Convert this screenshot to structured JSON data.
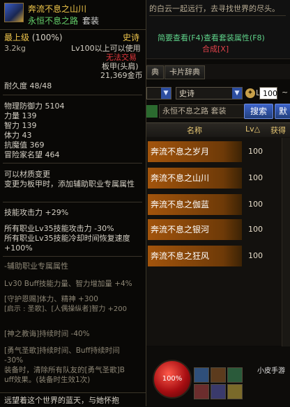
{
  "tooltip": {
    "item_name": "奔流不息之山川",
    "set_name": "永恒不息之路",
    "set_suffix": "套装",
    "level_req": "最上级",
    "level_pct": "(100%)",
    "rarity": "史诗",
    "weight": "3.2kg",
    "usable": "Lv100以上可以使用",
    "trade": "无法交易",
    "slot": "板甲(头肩)",
    "price": "21,369金币",
    "durability": "耐久度  48/48",
    "stats": [
      "物理防御力 5104",
      "力量 139",
      "智力 139",
      "体力 43",
      "抗魔值 369",
      "冒险家名望 464"
    ],
    "material": "可以材质变更",
    "material_note": "变更为板甲时，添加辅助职业专属属性",
    "skill_atk": "技能攻击力 +29%",
    "lv35_line1": "所有职业Lv35技能攻击力 -30%",
    "lv35_line2": "所有职业Lv35技能冷却时间恢复速度",
    "lv35_line3": "+100%",
    "support_title": "-辅助职业专属属性",
    "support_lines": [
      "Lv30 Buff技能力量、智力增加量 +4%",
      "[守护恩赐]体力、精神 +300",
      "[启示 : 圣歌]、[人偶操纵者]智力 +200",
      "[神之教诲]持续时间 -40%",
      "[勇气圣歌]持续时间、Buff持续时间",
      "-30%",
      "装备时，清除所有队友的[勇气圣歌]B",
      "uff效果。(装备时生效1次)"
    ],
    "flavor": "远望着这个世界的蓝天，与她怀抱"
  },
  "background": {
    "flavor_top": "的白云一起远行，去寻找世界的尽头。",
    "set_links": "简要查看(F4)查看套装属性(F8)",
    "synth": "合成[X]",
    "tabs": [
      "典",
      "卡片辞典"
    ],
    "filter_rarity": "史诗",
    "lv_from": "100",
    "set_chip": "永恒不息之路  套装",
    "search_button": "搜索",
    "extra_button": "默",
    "col_name": "名称",
    "col_lv": "Lv△",
    "col_obtain": "获得",
    "rows": [
      {
        "name": "奔流不息之岁月",
        "lv": "100"
      },
      {
        "name": "奔流不息之山川",
        "lv": "100"
      },
      {
        "name": "奔流不息之伽蓝",
        "lv": "100"
      },
      {
        "name": "奔流不息之银河",
        "lv": "100"
      },
      {
        "name": "奔流不息之狂风",
        "lv": "100"
      }
    ],
    "hp_text": "100%",
    "brand": "小皮手游"
  },
  "colors": {
    "rarity_epic": "#f0c64c",
    "set_green": "#66d36c",
    "warn_red": "#e3383d",
    "row_orange": "#a2540c",
    "button_blue": "#3c63c9"
  }
}
